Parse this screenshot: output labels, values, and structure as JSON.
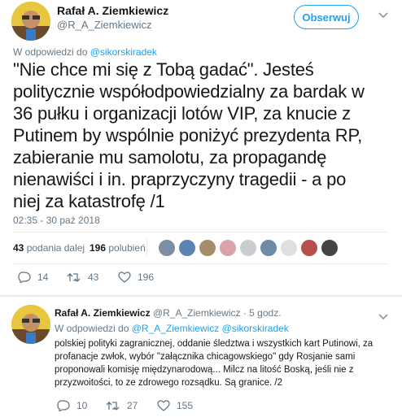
{
  "tweet": {
    "author_name": "Rafał A. Ziemkiewicz",
    "author_handle": "@R_A_Ziemkiewicz",
    "follow_label": "Obserwuj",
    "reply_prefix": "W odpowiedzi do",
    "reply_handle": "@sikorskiradek",
    "text": "\"Nie chce mi się z Tobą gadać\". Jesteś\npolitycznie współodpowiedzialny za bardak w\n36 pułku i organizacji lotów VIP, za knucie z\nPutinem by wspólnie poniżyć prezydenta RP,\nzabieranie mu samolotu, za propagandę\nnienawiści i in. praprzyczyny tragedii - a po\nniej za katastrofę /1",
    "timestamp": "02:35 - 30 paź 2018",
    "retweets_count": "43",
    "retweets_label": "podania dalej",
    "likes_count": "196",
    "likes_label": "polubień",
    "actions": {
      "replies": "14",
      "retweets": "43",
      "likes": "196"
    }
  },
  "reply_tweet": {
    "author_name": "Rafał A. Ziemkiewicz",
    "author_handle": "@R_A_Ziemkiewicz",
    "time": "· 5 godz.",
    "reply_prefix": "W odpowiedzi do",
    "reply_handles": "@R_A_Ziemkiewicz @sikorskiradek",
    "text": "polskiej polityki zagranicznej, oddanie śledztwa i wszystkich kart Putinowi, za\nprofanacje zwłok, wybór \"załącznika chicagowskiego\" gdy Rosjanie sami\nproponowali komisję międzynarodową... Milcz na litość Boską, jeśli nie z\nprzyzwoitości, to ze zdrowego rozsądku. Są granice. /2",
    "actions": {
      "replies": "10",
      "retweets": "27",
      "likes": "155"
    }
  },
  "colors": {
    "accent": "#1da1f2",
    "muted": "#657786",
    "text": "#14171a",
    "divider": "#e6ecf0"
  },
  "icons": [
    "chevron-down-icon",
    "reply-icon",
    "retweet-icon",
    "heart-icon",
    "avatar"
  ]
}
